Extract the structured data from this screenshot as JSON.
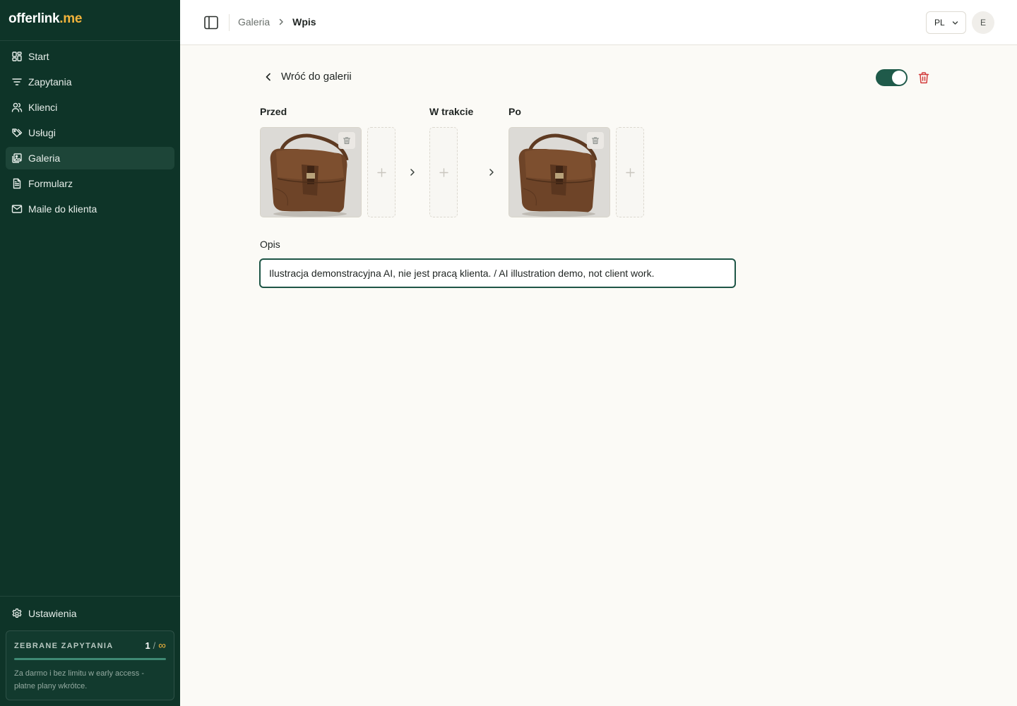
{
  "app": {
    "logo_main": "offerlink",
    "logo_accent": ".me"
  },
  "sidebar": {
    "items": [
      {
        "label": "Start",
        "icon": "dashboard-icon"
      },
      {
        "label": "Zapytania",
        "icon": "filter-lines-icon"
      },
      {
        "label": "Klienci",
        "icon": "users-icon"
      },
      {
        "label": "Usługi",
        "icon": "tags-icon"
      },
      {
        "label": "Galeria",
        "icon": "images-icon",
        "active": true
      },
      {
        "label": "Formularz",
        "icon": "document-icon"
      },
      {
        "label": "Maile do klienta",
        "icon": "mail-icon"
      }
    ],
    "settings_label": "Ustawienia",
    "quota": {
      "label": "ZEBRANE ZAPYTANIA",
      "count": "1",
      "slash": "/",
      "limit_symbol": "∞",
      "note": "Za darmo i bez limitu w early access - płatne plany wkrótce.",
      "progress": 1.0
    }
  },
  "header": {
    "breadcrumb_parent": "Galeria",
    "breadcrumb_current": "Wpis",
    "language": "PL",
    "avatar_initial": "E"
  },
  "main": {
    "back_label": "Wróć do galerii",
    "published": true,
    "stages": {
      "before": "Przed",
      "during": "W trakcie",
      "after": "Po"
    },
    "description_label": "Opis",
    "description_value": "Ilustracja demonstracyjna AI, nie jest pracą klienta. / AI illustration demo, not client work."
  },
  "colors": {
    "sidebar_bg": "#0e3428",
    "accent": "#f2b33c",
    "primary": "#1f5a4a",
    "danger": "#d23b3b"
  }
}
